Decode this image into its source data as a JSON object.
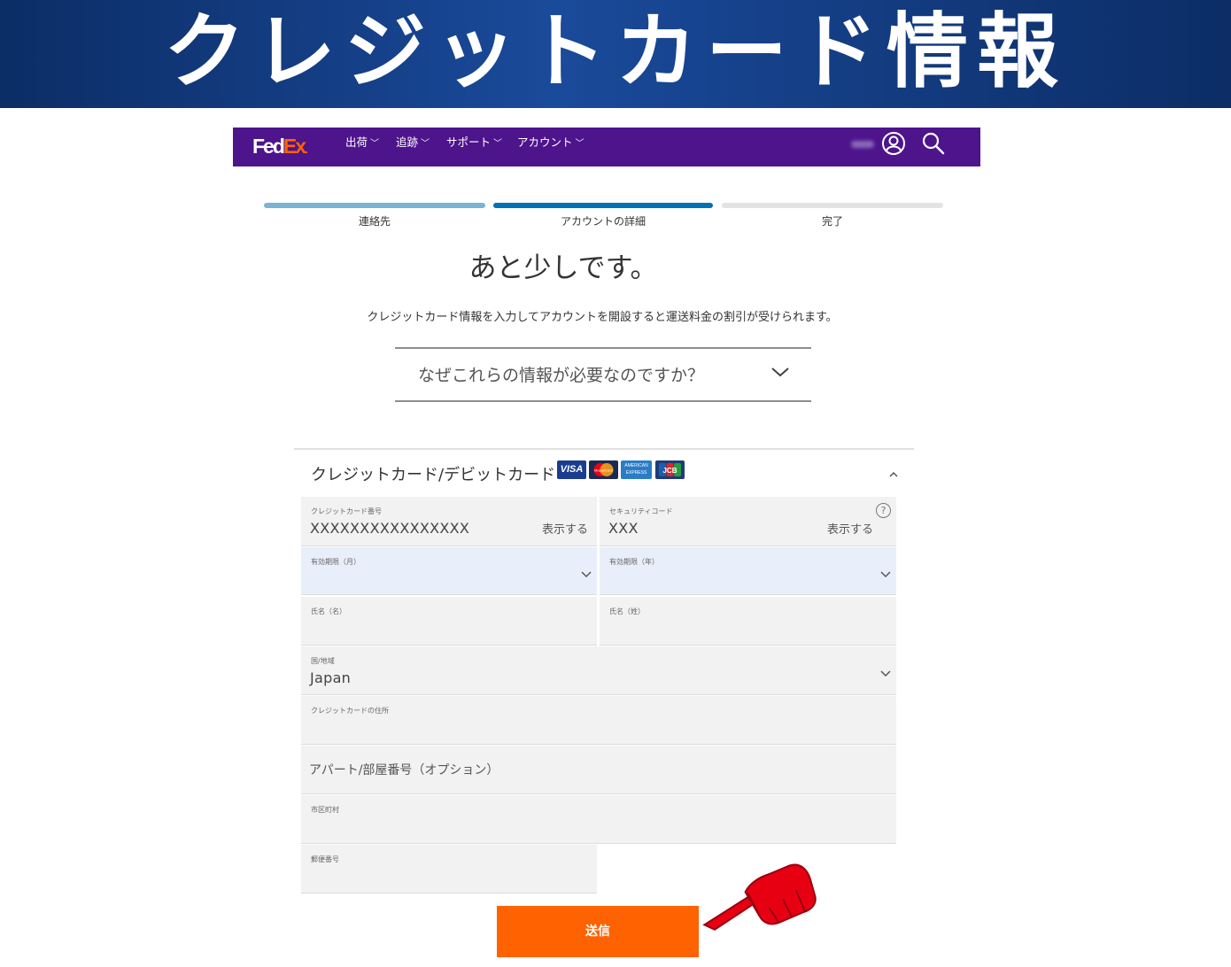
{
  "banner": {
    "title": "クレジットカード情報"
  },
  "nav": {
    "logo_fed": "Fed",
    "logo_ex": "Ex",
    "logo_dot": ".",
    "items": [
      {
        "label": "出荷"
      },
      {
        "label": "追跡"
      },
      {
        "label": "サポート"
      },
      {
        "label": "アカウント"
      }
    ],
    "icons": [
      "user-icon",
      "search-icon"
    ]
  },
  "progress": {
    "steps": [
      {
        "label": "連絡先",
        "state": "complete"
      },
      {
        "label": "アカウントの詳細",
        "state": "current"
      },
      {
        "label": "完了",
        "state": "pending"
      }
    ]
  },
  "page": {
    "heading": "あと少しです。",
    "subtext": "クレジットカード情報を入力してアカウントを開設すると運送料金の割引が受けられます。"
  },
  "accordion": {
    "label": "なぜこれらの情報が必要なのですか？"
  },
  "card_section": {
    "title": "クレジットカード/デビットカード",
    "card_logos": [
      {
        "label": "VISA"
      },
      {
        "label": "MasterCard"
      },
      {
        "label": "AMERICAN EXPRESS"
      },
      {
        "label": "JCB"
      }
    ],
    "fields": {
      "card_number": {
        "label": "クレジットカード番号",
        "value": "XXXXXXXXXXXXXXXX",
        "show": "表示する"
      },
      "security_code": {
        "label": "セキュリティコード",
        "value": "XXX",
        "show": "表示する",
        "help": "?"
      },
      "exp_month": {
        "label": "有効期限（月）",
        "value": ""
      },
      "exp_year": {
        "label": "有効期限（年）",
        "value": ""
      },
      "first_name": {
        "label": "氏名（名）",
        "value": ""
      },
      "last_name": {
        "label": "氏名（姓）",
        "value": ""
      },
      "country": {
        "label": "国/地域",
        "value": "Japan"
      },
      "address": {
        "label": "クレジットカードの住所",
        "value": ""
      },
      "apartment": {
        "placeholder": "アパート/部屋番号（オプション）"
      },
      "city": {
        "label": "市区町村",
        "value": ""
      },
      "postal": {
        "label": "郵便番号",
        "value": ""
      }
    }
  },
  "submit": {
    "label": "送信"
  },
  "colors": {
    "banner": "#0c2d66",
    "nav": "#4d148c",
    "fedex_orange": "#ff6200",
    "step_complete": "#7ab3d6",
    "step_current": "#0071b3",
    "step_pending": "#e3e3e3",
    "pointer": "#e60012"
  }
}
